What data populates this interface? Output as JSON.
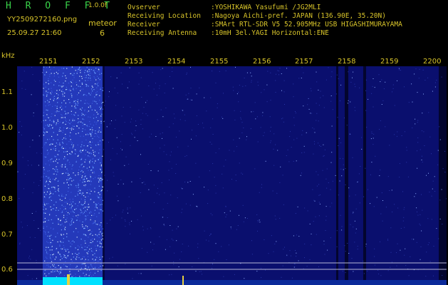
{
  "header": {
    "app_title": "H R O F F T",
    "version": "1.0.0f",
    "filename": "YY2509272160.png",
    "datetime": "25.09.27 21:60",
    "meteor_label": "meteor",
    "meteor_count": "6"
  },
  "station": [
    {
      "key": "Ovserver",
      "value": ":YOSHIKAWA Yasufumi /JG2MLI"
    },
    {
      "key": "Receiving Location",
      "value": ":Nagoya Aichi-pref. JAPAN (136.90E, 35.20N)"
    },
    {
      "key": "Receiver",
      "value": ":SMArt RTL-SDR V5 52.905MHz USB HIGASHIMURAYAMA"
    },
    {
      "key": "Receiving Antenna",
      "value": ":10mH 3el.YAGI Horizontal:ENE"
    }
  ],
  "axes": {
    "y_unit": "kHz",
    "x_labels": [
      "2151",
      "2152",
      "2153",
      "2154",
      "2155",
      "2156",
      "2157",
      "2158",
      "2159",
      "2200"
    ],
    "y_labels": [
      "1.1",
      "1.0",
      "0.9",
      "0.8",
      "0.7",
      "0.6"
    ]
  },
  "colors": {
    "background": "#000000",
    "label": "#d8c42a",
    "title": "#39d44a",
    "waterfall_base": "#0a0f6e",
    "signal": "#00e0ff"
  }
}
